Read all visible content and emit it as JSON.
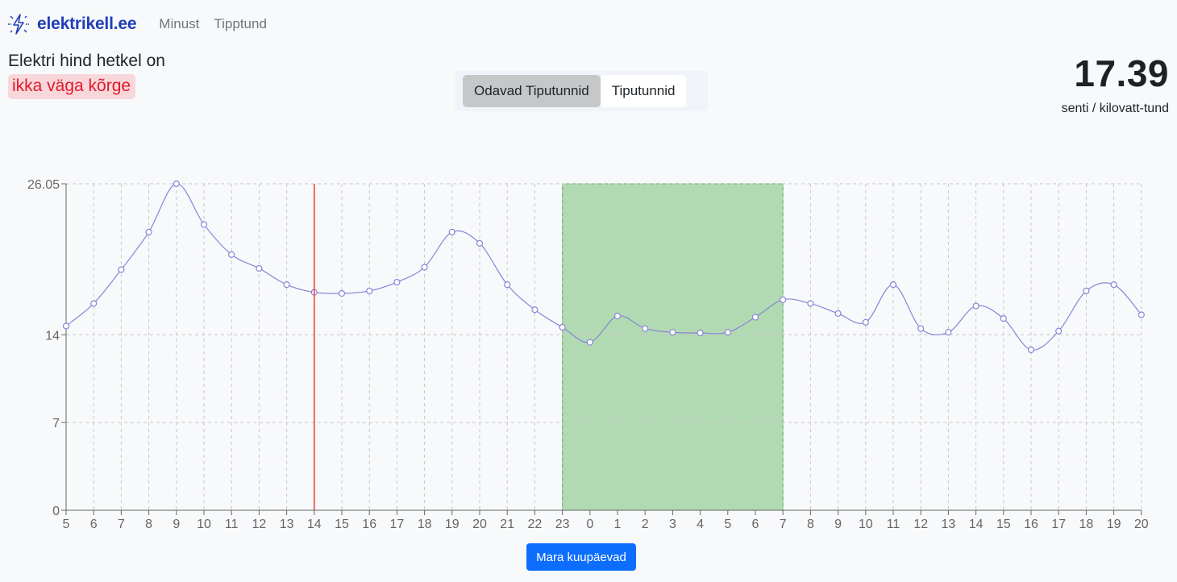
{
  "header": {
    "brand": "elektrikell.ee",
    "nav": [
      "Minust",
      "Tipptund"
    ]
  },
  "status": {
    "label": "Elektri hind hetkel on",
    "badge": "ikka väga kõrge"
  },
  "toggle": {
    "options": [
      "Odavad Tiputunnid",
      "Tiputunnid"
    ],
    "active_index": 0
  },
  "price": {
    "value": "17.39",
    "unit": "senti / kilovatt-tund"
  },
  "button": {
    "label": "Mara kuupäevad"
  },
  "colors": {
    "line": "#8884d8",
    "highlight": "#82c482",
    "current_line": "#e53935",
    "button": "#0d6efd",
    "brand": "#1f3fb8",
    "badge_text": "#e0192d",
    "badge_bg": "#f8d7da"
  },
  "chart_data": {
    "type": "line",
    "x": [
      "5",
      "6",
      "7",
      "8",
      "9",
      "10",
      "11",
      "12",
      "13",
      "14",
      "15",
      "16",
      "17",
      "18",
      "19",
      "20",
      "21",
      "22",
      "23",
      "0",
      "1",
      "2",
      "3",
      "4",
      "5",
      "6",
      "7",
      "8",
      "9",
      "10",
      "11",
      "12",
      "13",
      "14",
      "15",
      "16",
      "17",
      "18",
      "19",
      "20"
    ],
    "values": [
      14.7,
      16.5,
      19.2,
      22.2,
      26.05,
      22.8,
      20.4,
      19.3,
      18.0,
      17.39,
      17.3,
      17.5,
      18.2,
      19.4,
      22.2,
      21.3,
      18.0,
      16.0,
      14.6,
      13.4,
      15.5,
      14.5,
      14.2,
      14.15,
      14.2,
      15.4,
      16.8,
      16.5,
      15.7,
      15.0,
      18.0,
      14.5,
      14.2,
      16.3,
      15.3,
      12.8,
      14.3,
      17.5,
      18.0,
      15.6
    ],
    "y_ticks": [
      0,
      7,
      14,
      26.05
    ],
    "ylim": [
      0,
      26.05
    ],
    "current_index": 9,
    "highlight_range": [
      18,
      26
    ],
    "grid": true
  }
}
